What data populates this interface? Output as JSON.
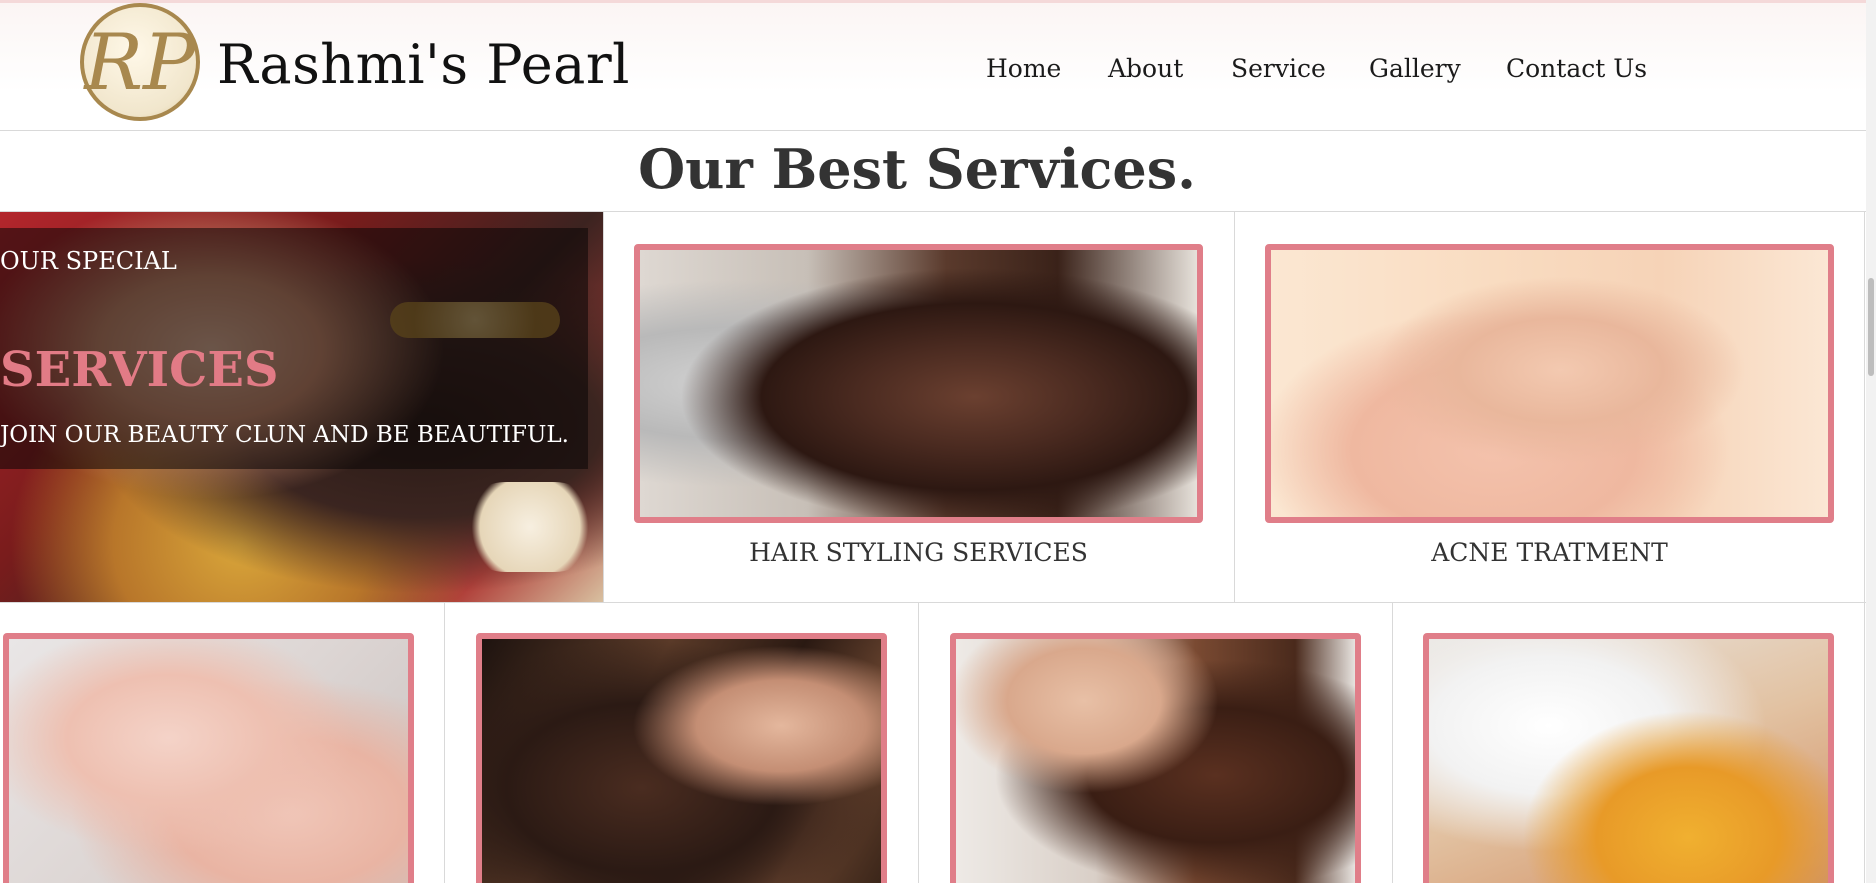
{
  "brand": {
    "logo_text": "RP",
    "name": "Rashmi's Pearl"
  },
  "nav": {
    "items": [
      {
        "label": "Home"
      },
      {
        "label": "About"
      },
      {
        "label": "Service"
      },
      {
        "label": "Gallery"
      },
      {
        "label": "Contact Us"
      }
    ]
  },
  "services_section": {
    "title_bold": "Our Best",
    "title_rest": "Services."
  },
  "promo": {
    "small": "OUR SPECIAL",
    "big": "SERVICES",
    "sub": "JOIN OUR BEAUTY CLUN AND BE BEAUTIFUL."
  },
  "featured": [
    {
      "caption": "HAIR STYLING SERVICES"
    },
    {
      "caption": "ACNE TRATMENT"
    }
  ],
  "colors": {
    "accent": "#e07e89",
    "logo_gold": "#a8884e",
    "promo_title": "#e27b86"
  }
}
